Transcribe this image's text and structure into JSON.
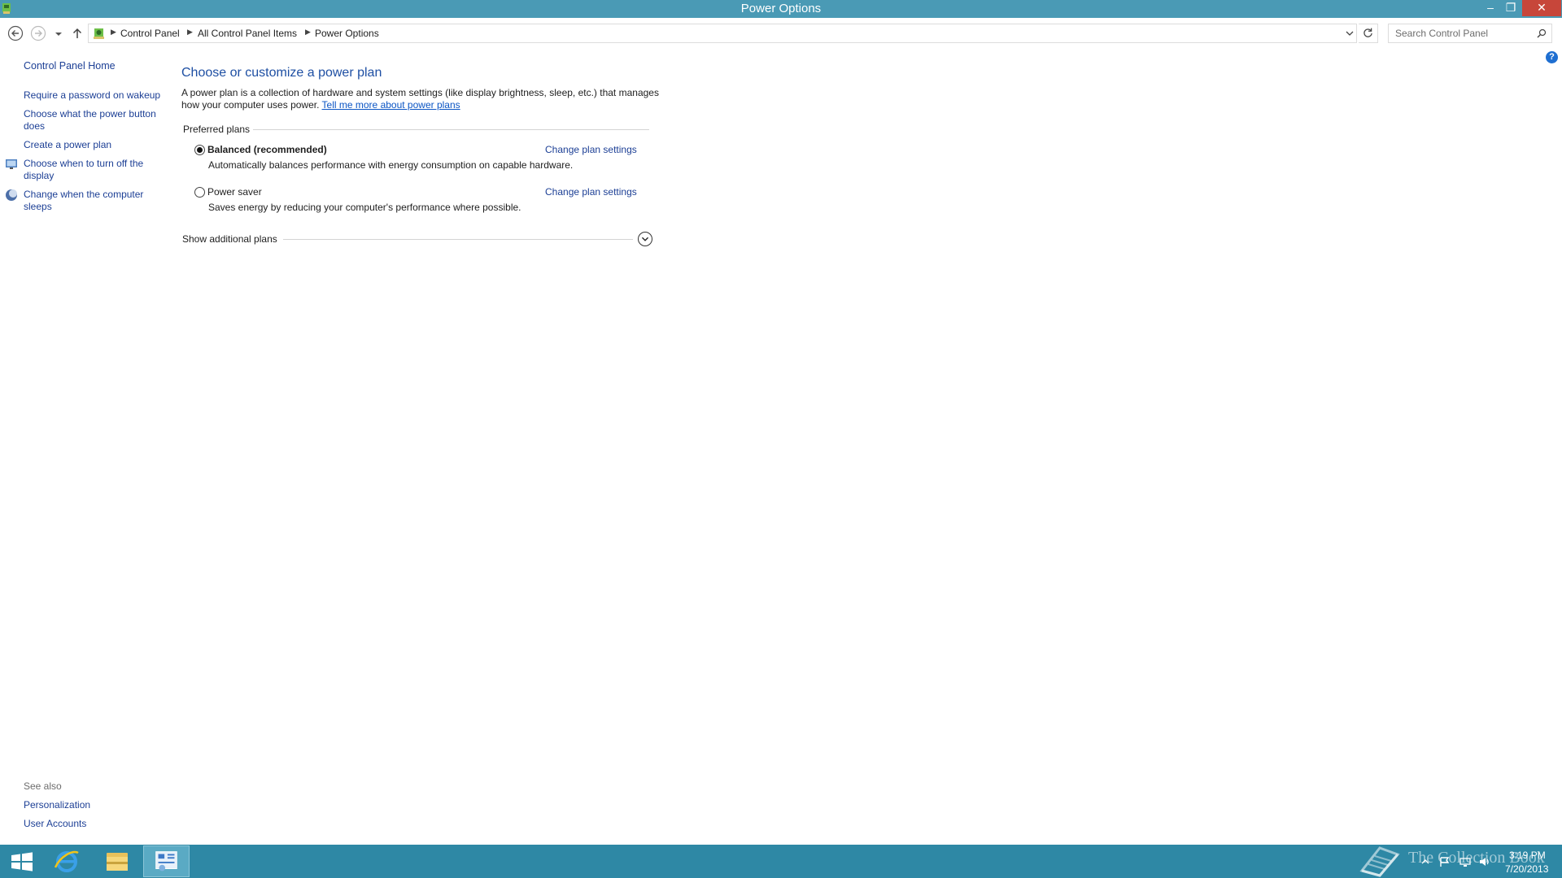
{
  "window": {
    "title": "Power Options",
    "controls": {
      "minimize": "–",
      "maximize": "❐",
      "close": "✕"
    }
  },
  "address_bar": {
    "breadcrumbs": [
      "Control Panel",
      "All Control Panel Items",
      "Power Options"
    ],
    "search_placeholder": "Search Control Panel"
  },
  "left_pane": {
    "home": "Control Panel Home",
    "links": [
      "Require a password on wakeup",
      "Choose what the power button does",
      "Create a power plan",
      "Choose when to turn off the display",
      "Change when the computer sleeps"
    ],
    "see_also_label": "See also",
    "see_also": [
      "Personalization",
      "User Accounts"
    ]
  },
  "main": {
    "heading": "Choose or customize a power plan",
    "intro": "A power plan is a collection of hardware and system settings (like display brightness, sleep, etc.) that manages how your computer uses power.",
    "intro_link": "Tell me more about power plans",
    "preferred_label": "Preferred plans",
    "plans": [
      {
        "name": "Balanced (recommended)",
        "description": "Automatically balances performance with energy consumption on capable hardware.",
        "link": "Change plan settings",
        "selected": true
      },
      {
        "name": "Power saver",
        "description": "Saves energy by reducing your computer's performance where possible.",
        "link": "Change plan settings",
        "selected": false
      }
    ],
    "show_additional": "Show additional plans"
  },
  "taskbar": {
    "watermark": "The Collection Book",
    "time": "3:19 PM",
    "date": "7/20/2013"
  },
  "colors": {
    "titlebar": "#4a9ab5",
    "taskbar": "#2e88a5",
    "link": "#1c3f95",
    "heading": "#1e4fa3",
    "close": "#c7463a"
  },
  "icons": [
    "app-icon",
    "back-arrow-icon",
    "forward-arrow-icon",
    "recent-pages-icon",
    "up-arrow-icon",
    "control-panel-icon",
    "refresh-icon",
    "search-icon",
    "help-icon",
    "display-icon",
    "sleep-icon",
    "windows-logo-icon",
    "internet-explorer-icon",
    "file-explorer-icon",
    "control-panel-taskbar-icon",
    "book-icon"
  ]
}
